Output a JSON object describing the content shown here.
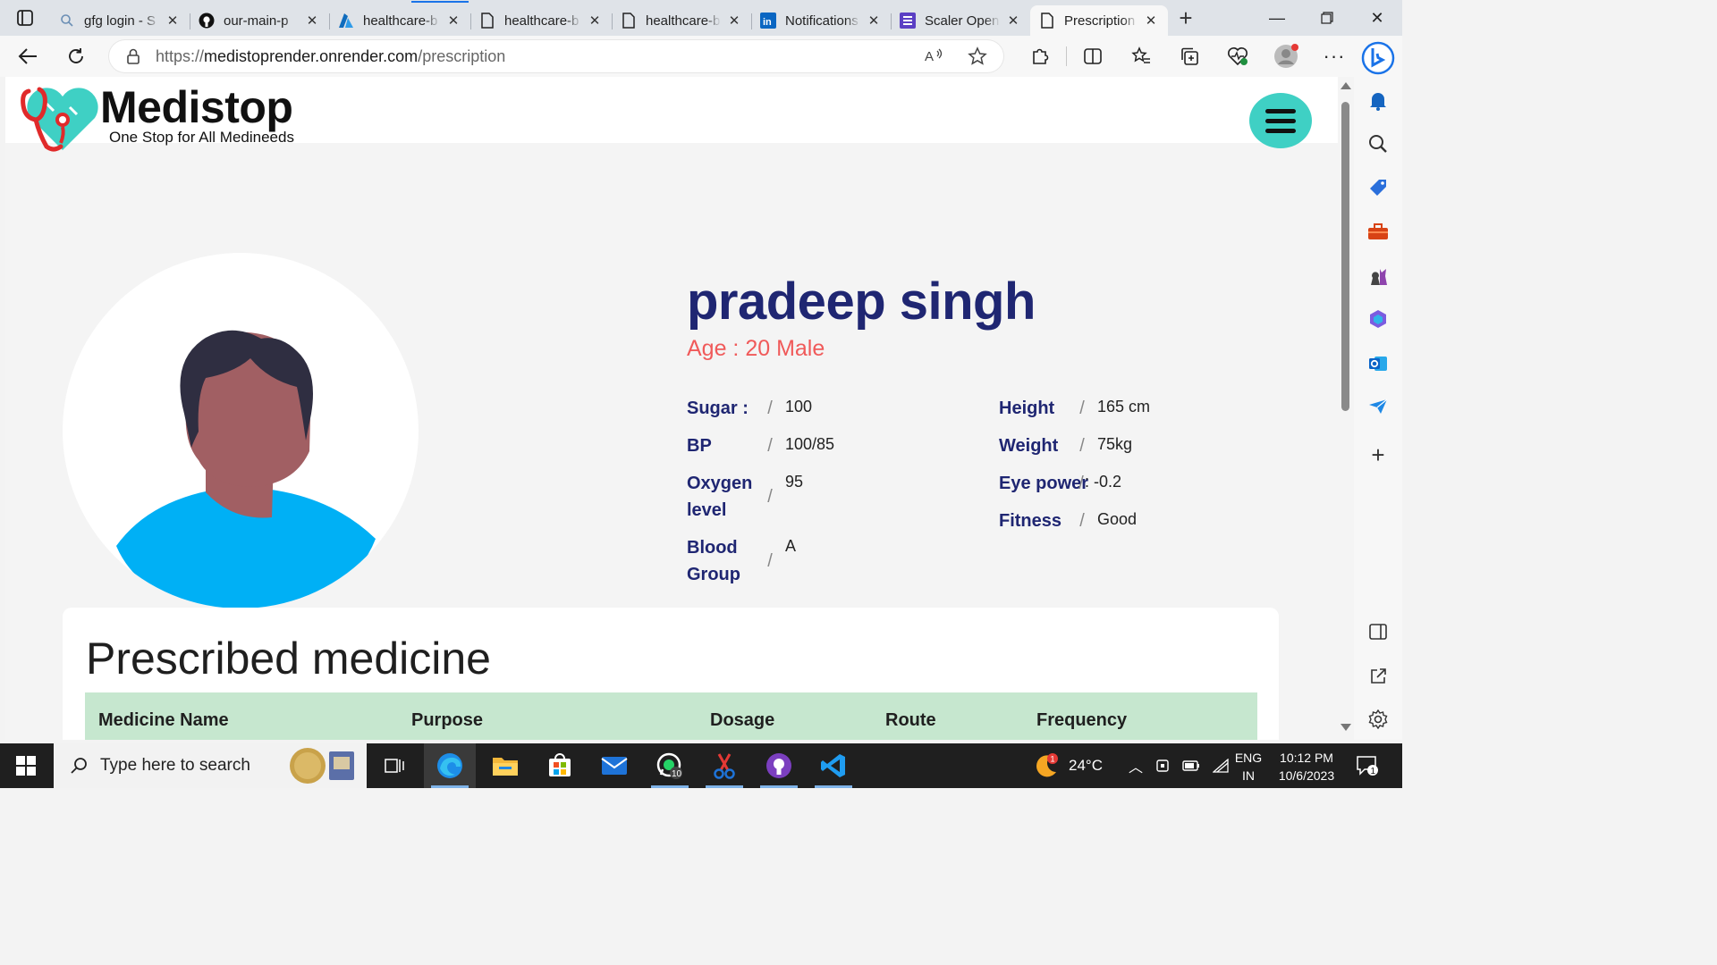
{
  "browser": {
    "tabs": [
      {
        "title": "gfg login - S",
        "icon": "search-icon"
      },
      {
        "title": "our-main-p",
        "icon": "github-icon"
      },
      {
        "title": "healthcare-b",
        "icon": "azure-icon"
      },
      {
        "title": "healthcare-b",
        "icon": "page-icon"
      },
      {
        "title": "healthcare-b",
        "icon": "page-icon"
      },
      {
        "title": "Notifications",
        "icon": "linkedin-icon"
      },
      {
        "title": "Scaler Open",
        "icon": "scaler-icon"
      },
      {
        "title": "Prescription",
        "icon": "page-icon",
        "active": true
      }
    ],
    "address": {
      "scheme": "https://",
      "host": "medistoprender.onrender.com",
      "path": "/prescription"
    }
  },
  "site": {
    "brand": "Medistop",
    "tagline": "One Stop for All Medineeds",
    "brand_color": "#3fd0c4"
  },
  "patient": {
    "name": "pradeep singh",
    "age_line": "Age : 20 Male",
    "sep": "/",
    "vitals_left": [
      {
        "label": "Sugar :",
        "value": "100"
      },
      {
        "label": "BP",
        "value": "100/85"
      },
      {
        "label": "Oxygen level",
        "value": "95"
      },
      {
        "label": "Blood Group",
        "value": "A"
      }
    ],
    "vitals_right": [
      {
        "label": "Height",
        "value": "165 cm"
      },
      {
        "label": "Weight",
        "value": "75kg"
      },
      {
        "label": "Eye power",
        "value": ": -0.2"
      },
      {
        "label": "Fitness",
        "value": "Good"
      }
    ]
  },
  "prescription": {
    "title": "Prescribed medicine",
    "columns": [
      "Medicine Name",
      "Purpose",
      "Dosage",
      "Route",
      "Frequency"
    ],
    "header_color": "#c6e7cf"
  },
  "taskbar": {
    "search_placeholder": "Type here to search",
    "weather": "24°C",
    "weather_badge": "1",
    "lang_1": "ENG",
    "lang_2": "IN",
    "time": "10:12 PM",
    "date": "10/6/2023",
    "notification_count": "1",
    "whatsapp_badge": "10"
  }
}
